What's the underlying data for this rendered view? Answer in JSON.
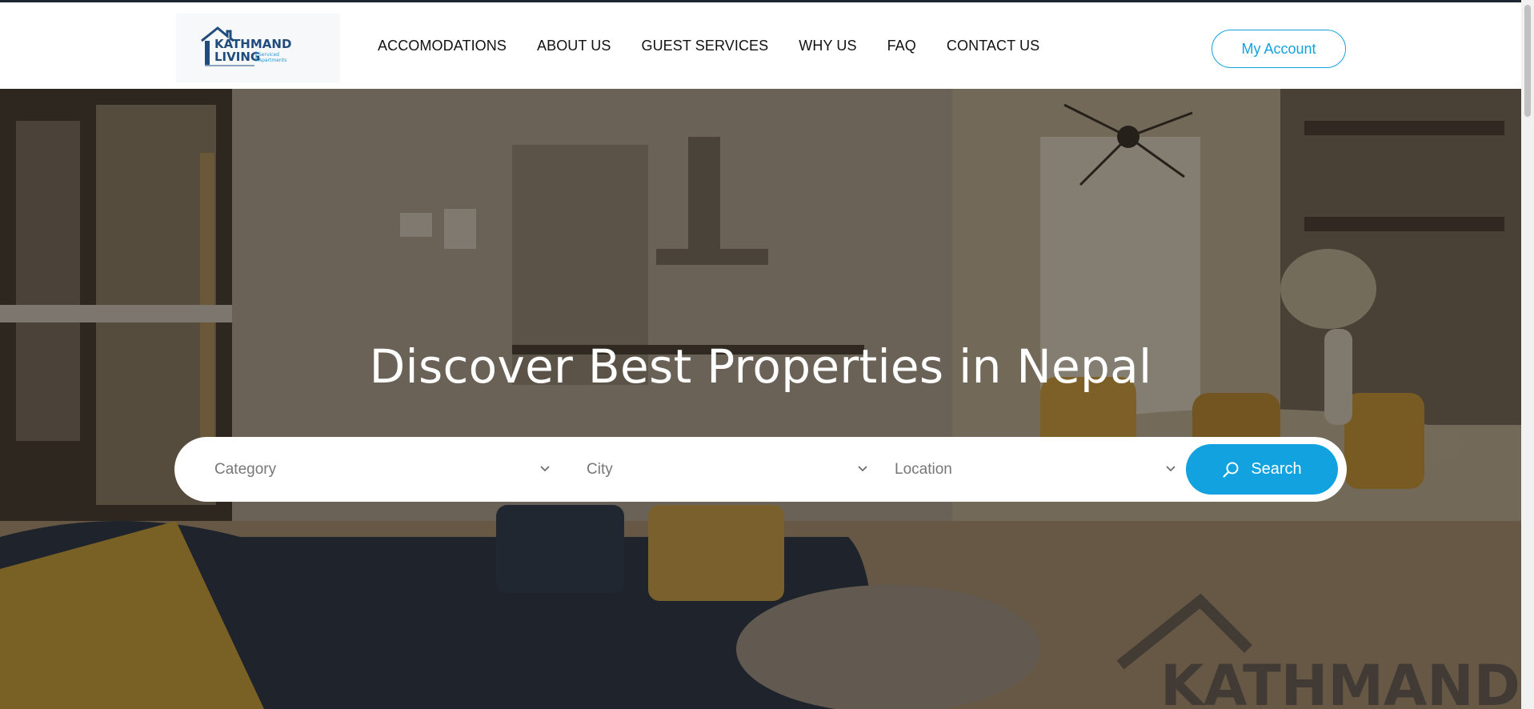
{
  "brand": {
    "logo_line1": "KATHMANDU",
    "logo_line2": "LIVING",
    "logo_sub1": "Serviced",
    "logo_sub2": "Apartments"
  },
  "nav": {
    "items": [
      {
        "label": "ACCOMODATIONS"
      },
      {
        "label": "ABOUT US"
      },
      {
        "label": "GUEST SERVICES"
      },
      {
        "label": "WHY US"
      },
      {
        "label": "FAQ"
      },
      {
        "label": "CONTACT US"
      }
    ],
    "account_label": "My Account"
  },
  "hero": {
    "title": "Discover Best Properties in Nepal",
    "watermark": "KATHMANDU"
  },
  "search": {
    "category_placeholder": "Category",
    "city_placeholder": "City",
    "location_placeholder": "Location",
    "button_label": "Search"
  },
  "colors": {
    "accent": "#12a2e0",
    "logo": "#1f4c7c",
    "text_dark": "#111111"
  }
}
